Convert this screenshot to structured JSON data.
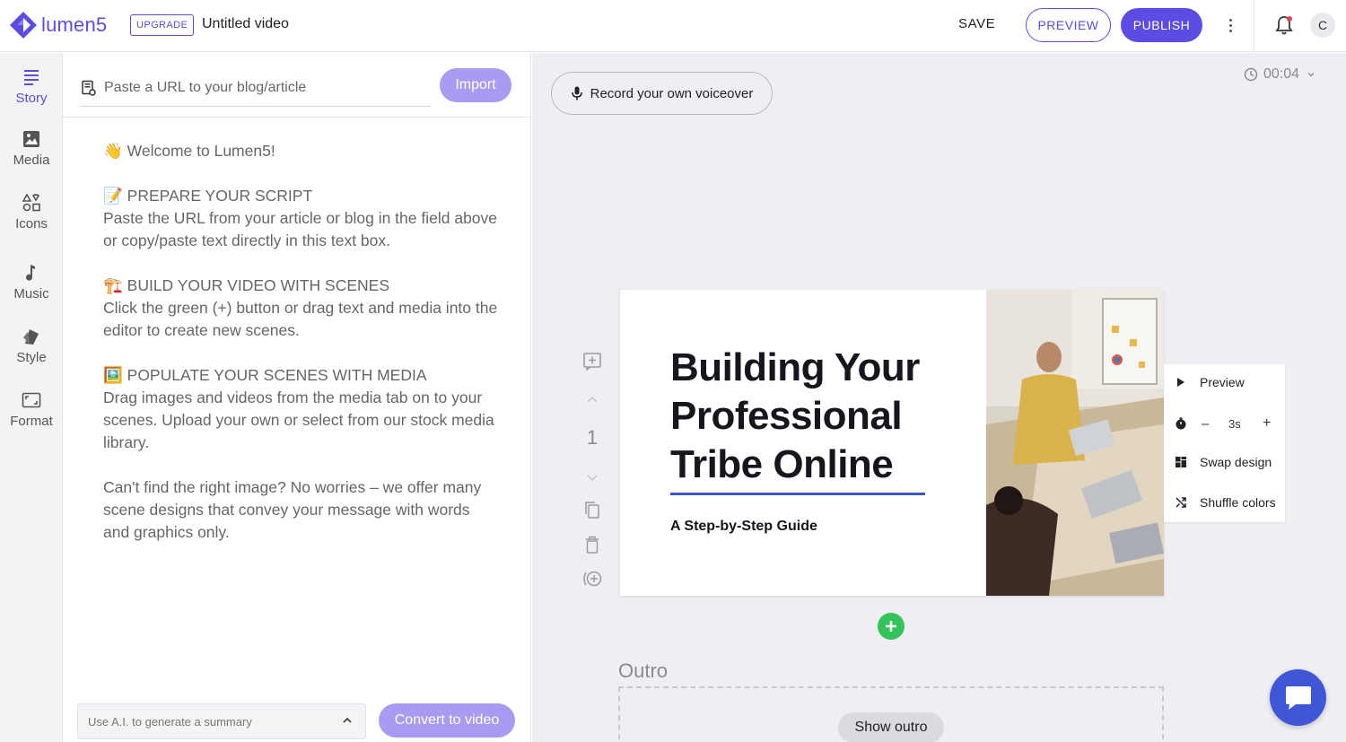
{
  "brand": {
    "name": "lumen5",
    "accent": "#5b4de3"
  },
  "header": {
    "upgrade_label": "UPGRADE",
    "doc_title": "Untitled video",
    "save_label": "SAVE",
    "preview_label": "PREVIEW",
    "publish_label": "PUBLISH",
    "avatar_initial": "C"
  },
  "sidebar": {
    "items": [
      {
        "label": "Story",
        "icon": "story-lines-icon",
        "active": true
      },
      {
        "label": "Media",
        "icon": "image-icon"
      },
      {
        "label": "Icons",
        "icon": "shapes-icon"
      },
      {
        "label": "Music",
        "icon": "music-note-icon"
      },
      {
        "label": "Style",
        "icon": "style-swatch-icon"
      },
      {
        "label": "Format",
        "icon": "aspect-ratio-icon"
      }
    ]
  },
  "story": {
    "url_placeholder": "Paste a URL to your blog/article",
    "import_label": "Import",
    "paragraphs": [
      "👋 Welcome to Lumen5!",
      "📝 PREPARE YOUR SCRIPT\nPaste the URL from your article or blog in the field above or copy/paste text directly in this text box.",
      "🏗️ BUILD YOUR VIDEO WITH SCENES\nClick the green (+) button or drag text and media into the editor to create new scenes.",
      "🖼️ POPULATE YOUR SCENES WITH MEDIA\nDrag images and videos from the media tab on to your scenes. Upload your own or select from our stock media library.",
      "Can't find the right image? No worries – we offer many scene designs that convey your message with words and graphics only."
    ],
    "ai_summary_label": "Use A.I. to generate a summary",
    "convert_label": "Convert to video"
  },
  "canvas": {
    "voiceover_label": "Record your own voiceover",
    "duration": "00:04",
    "scene": {
      "number": "1",
      "title": "Building Your\nProfessional\nTribe Online",
      "subtitle": "A Step-by-Step Guide"
    },
    "scene_menu": {
      "preview_label": "Preview",
      "duration_value": "3s",
      "minus_label": "–",
      "plus_label": "+",
      "swap_label": "Swap design",
      "shuffle_label": "Shuffle colors"
    },
    "outro_label": "Outro",
    "show_outro_label": "Show outro"
  }
}
